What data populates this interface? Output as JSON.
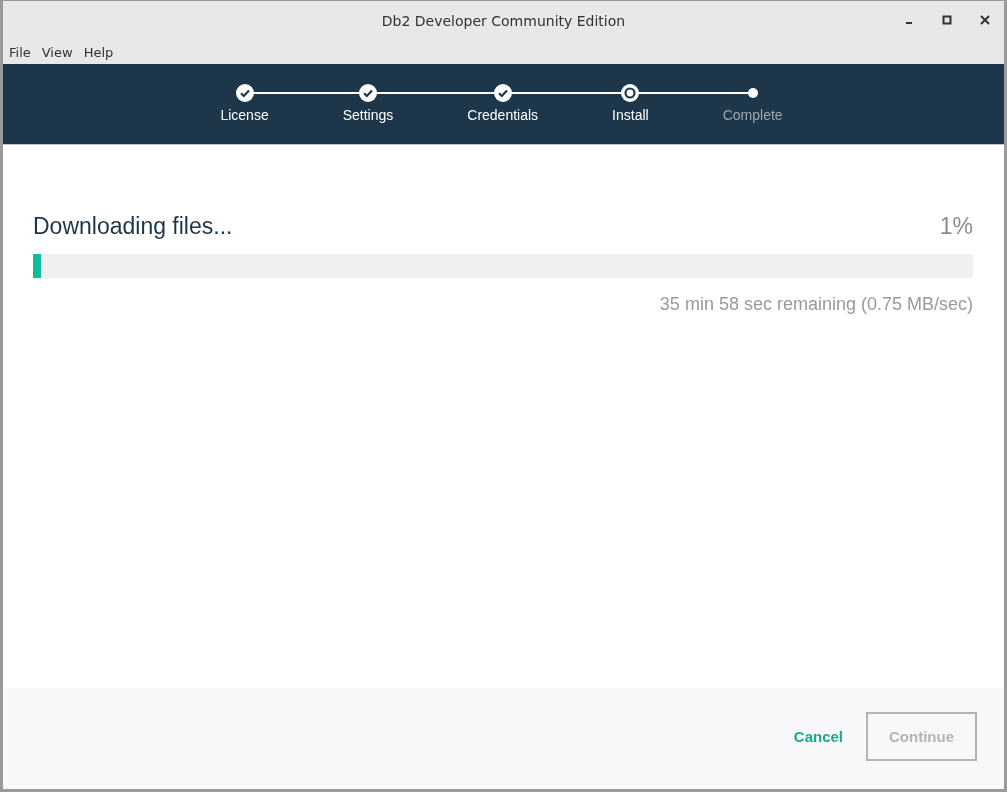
{
  "window": {
    "title": "Db2 Developer Community Edition"
  },
  "menu": [
    "File",
    "View",
    "Help"
  ],
  "steps": [
    {
      "label": "License",
      "kind": "done"
    },
    {
      "label": "Settings",
      "kind": "done"
    },
    {
      "label": "Credentials",
      "kind": "done"
    },
    {
      "label": "Install",
      "kind": "current"
    },
    {
      "label": "Complete",
      "kind": "pending"
    }
  ],
  "progress": {
    "title": "Downloading files...",
    "percent": "1%",
    "level": 0.009,
    "remaining": "35 min 58 sec remaining (0.75 MB/sec)"
  },
  "buttons": {
    "cancel": {
      "label": "Cancel"
    },
    "continue": {
      "label": "Continue",
      "disabled": true
    }
  }
}
